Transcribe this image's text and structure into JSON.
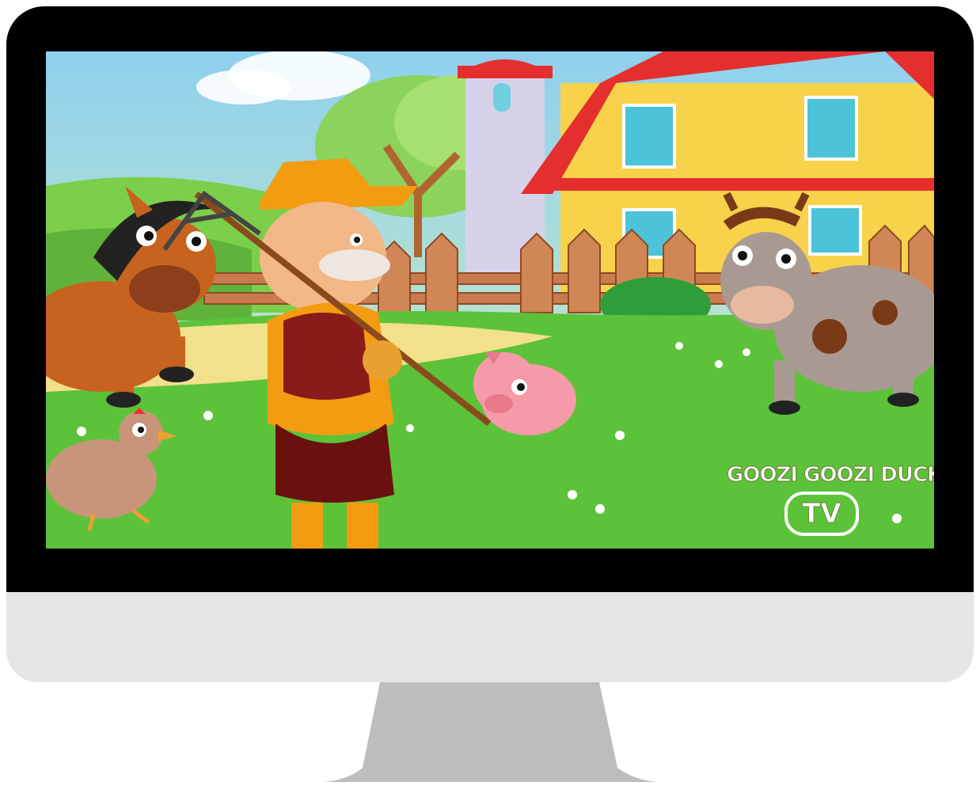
{
  "display": {
    "bezel_color": "#000000",
    "chin_color": "#e6e6e6",
    "stand_color": "#bdbdbd"
  },
  "video": {
    "scene": "farm-cartoon",
    "logo": {
      "brand_text": "GOOZI GOOZI DUCK",
      "badge_text": "TV"
    }
  },
  "colors": {
    "grass": "#5cc23a",
    "sky": "#9bd3ee",
    "barn_wall": "#f7d24a",
    "barn_roof": "#e52e2e",
    "fence": "#c97b4e",
    "farmer_hat": "#f39c12"
  }
}
